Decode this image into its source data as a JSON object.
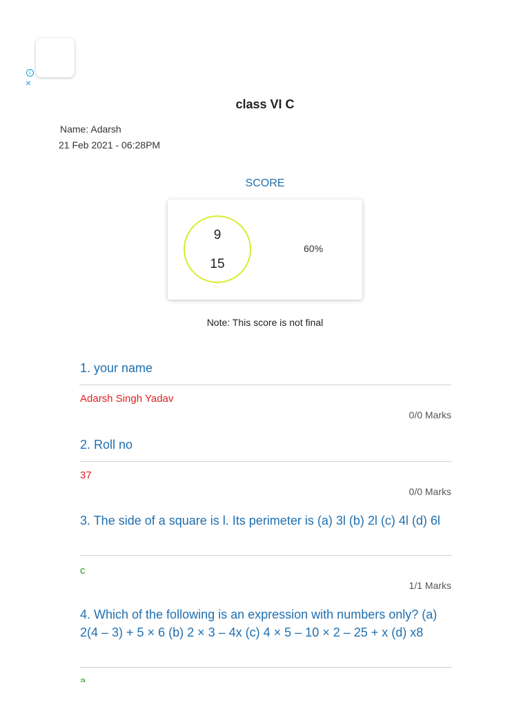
{
  "ad": {
    "info_glyph": "i",
    "close_glyph": "×"
  },
  "header": {
    "class_title": "class VI C",
    "name": "Name: Adarsh",
    "datetime": "21 Feb 2021 - 06:28PM"
  },
  "score": {
    "label": "SCORE",
    "obtained": "9",
    "total": "15",
    "percent": "60%",
    "note": "Note: This score is not final",
    "ring_color": "#d8ec2a"
  },
  "questions": [
    {
      "text": "1. your name",
      "answer": "Adarsh Singh Yadav",
      "status": "wrong",
      "marks": "0/0 Marks"
    },
    {
      "text": "2. Roll no",
      "answer": "37",
      "status": "wrong",
      "marks": "0/0 Marks"
    },
    {
      "text": "3. The side of a square is l. Its perimeter is (a) 3l (b) 2l (c) 4l (d) 6l",
      "answer": "c",
      "status": "right",
      "marks": "1/1 Marks"
    },
    {
      "text": "4. Which of the following is an expression with numbers only? (a) 2(4 – 3) + 5 × 6 (b) 2 × 3 – 4x (c) 4 × 5 – 10 × 2 – 25 + x (d) x8",
      "answer": "a",
      "status": "right",
      "marks": ""
    }
  ],
  "colors": {
    "question_blue": "#1f6fb0",
    "wrong_red": "#e02020",
    "right_green": "#2e9a2e"
  }
}
